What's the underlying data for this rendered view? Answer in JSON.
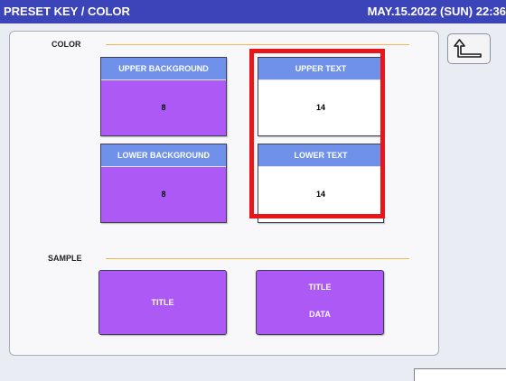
{
  "header": {
    "title": "PRESET KEY / COLOR",
    "datetime": "MAY.15.2022 (SUN)  22:36"
  },
  "color_section": {
    "label": "COLOR",
    "upper_background": {
      "title": "UPPER BACKGROUND",
      "value": "8"
    },
    "upper_text": {
      "title": "UPPER TEXT",
      "value": "14"
    },
    "lower_background": {
      "title": "LOWER BACKGROUND",
      "value": "8"
    },
    "lower_text": {
      "title": "LOWER TEXT",
      "value": "14"
    }
  },
  "sample_section": {
    "label": "SAMPLE",
    "sample1": {
      "line1": "TITLE"
    },
    "sample2": {
      "line1": "TITLE",
      "line2": "DATA"
    }
  },
  "icons": {
    "back": "return-arrow-icon"
  },
  "colors": {
    "titlebar": "#3b44b8",
    "header_blue": "#6f91ea",
    "purple": "#ad59f6",
    "highlight_red": "#e8161a",
    "section_line": "#f0b84f"
  }
}
